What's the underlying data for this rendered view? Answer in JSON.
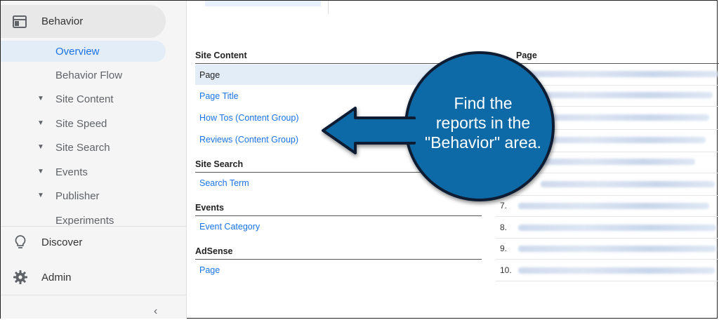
{
  "sidebar": {
    "behavior_label": "Behavior",
    "overview_label": "Overview",
    "items": [
      {
        "label": "Behavior Flow",
        "caret": ""
      },
      {
        "label": "Site Content",
        "caret": "▼"
      },
      {
        "label": "Site Speed",
        "caret": "▼"
      },
      {
        "label": "Site Search",
        "caret": "▼"
      },
      {
        "label": "Events",
        "caret": "▼"
      },
      {
        "label": "Publisher",
        "caret": "▼"
      },
      {
        "label": "Experiments",
        "caret": ""
      }
    ],
    "discover_label": "Discover",
    "admin_label": "Admin",
    "collapse_glyph": "‹"
  },
  "reports": {
    "site_content": {
      "header": "Site Content",
      "selected": "Page",
      "links": [
        "Page Title",
        "How Tos (Content Group)",
        "Reviews (Content Group)"
      ]
    },
    "site_search": {
      "header": "Site Search",
      "links": [
        "Search Term"
      ]
    },
    "events": {
      "header": "Events",
      "links": [
        "Event Category"
      ]
    },
    "adsense": {
      "header": "AdSense",
      "links": [
        "Page"
      ]
    }
  },
  "table": {
    "header": "Page",
    "row_numbers": [
      "7.",
      "8.",
      "9.",
      "10."
    ]
  },
  "callout": {
    "lines": [
      "Find the",
      "reports in the",
      "\"Behavior\" area."
    ],
    "fill_color": "#0e6aa6",
    "border_color": "#0b1f33"
  },
  "colors": {
    "accent": "#1a73e8",
    "selected_bg": "#e3edf8",
    "sidebar_bg": "#f5f5f5"
  }
}
